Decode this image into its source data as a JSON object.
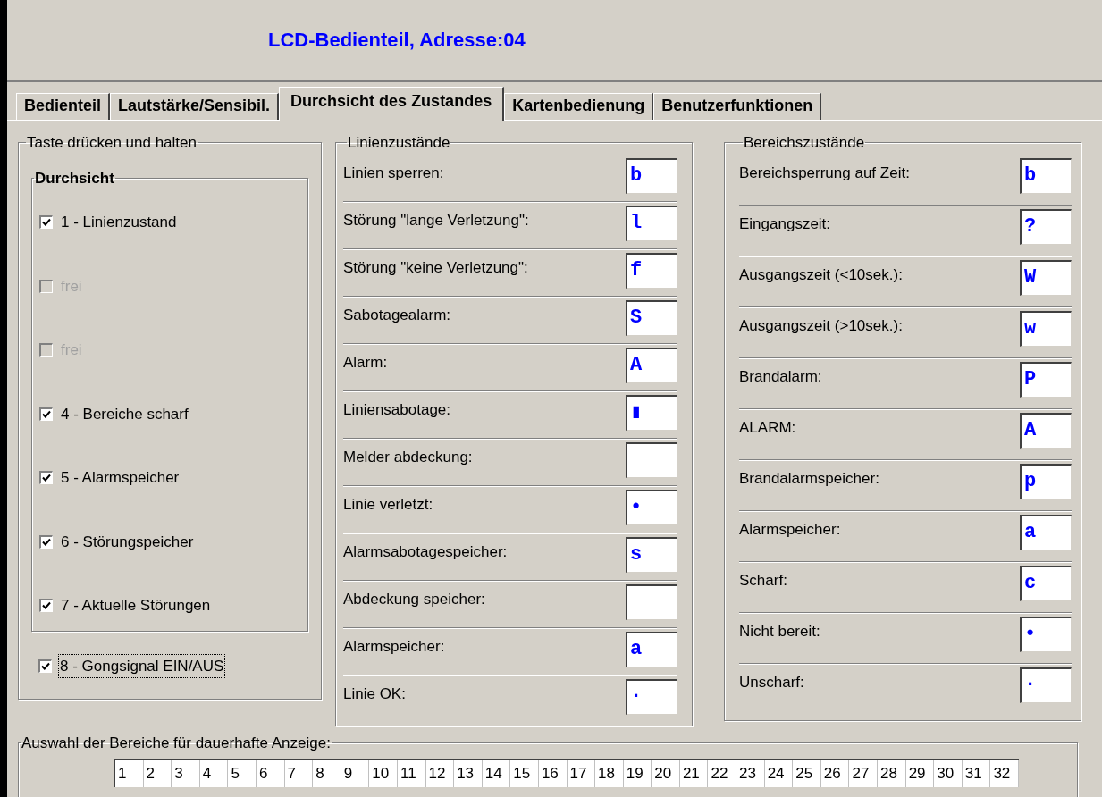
{
  "window": {
    "title": "LCD-Bedienteil, Adresse:04"
  },
  "tabs": [
    {
      "label": "Bedienteil",
      "selected": false
    },
    {
      "label": "Lautstärke/Sensibil.",
      "selected": false
    },
    {
      "label": "Durchsicht des Zustandes",
      "selected": true
    },
    {
      "label": "Kartenbedienung",
      "selected": false
    },
    {
      "label": "Benutzerfunktionen",
      "selected": false
    }
  ],
  "hold_key_group": {
    "title": "Taste drücken und halten",
    "review": {
      "title": "Durchsicht",
      "items": [
        {
          "label": "1 - Linienzustand",
          "checked": true,
          "disabled": false
        },
        {
          "label": "frei",
          "checked": false,
          "disabled": true
        },
        {
          "label": "frei",
          "checked": false,
          "disabled": true
        },
        {
          "label": "4 - Bereiche scharf",
          "checked": true,
          "disabled": false
        },
        {
          "label": "5 - Alarmspeicher",
          "checked": true,
          "disabled": false
        },
        {
          "label": "6 - Störungspeicher",
          "checked": true,
          "disabled": false
        },
        {
          "label": "7 - Aktuelle Störungen",
          "checked": true,
          "disabled": false
        }
      ]
    },
    "chime": {
      "label": "8 - Gongsignal EIN/AUS",
      "checked": true,
      "disabled": false,
      "focused": true
    }
  },
  "line_states": {
    "title": "Linienzustände",
    "rows": [
      {
        "label": "Linien sperren:",
        "value": "b"
      },
      {
        "label": "Störung \"lange Verletzung\":",
        "value": "l"
      },
      {
        "label": "Störung \"keine Verletzung\":",
        "value": "f"
      },
      {
        "label": "Sabotagealarm:",
        "value": "S"
      },
      {
        "label": "Alarm:",
        "value": "A"
      },
      {
        "label": "Liniensabotage:",
        "value": "▮"
      },
      {
        "label": "Melder abdeckung:"
      },
      {
        "label": "Linie verletzt:",
        "value": "•"
      },
      {
        "label": "Alarmsabotagespeicher:",
        "value": "s"
      },
      {
        "label": "Abdeckung speicher:"
      },
      {
        "label": "Alarmspeicher:",
        "value": "a"
      },
      {
        "label": "Linie OK:",
        "value": "·"
      }
    ]
  },
  "partition_states": {
    "title": "Bereichszustände",
    "rows": [
      {
        "label": "Bereichsperrung auf Zeit:",
        "value": "b"
      },
      {
        "label": "Eingangszeit:",
        "value": "?"
      },
      {
        "label": "Ausgangszeit (<10sek.):",
        "value": "W"
      },
      {
        "label": "Ausgangszeit (>10sek.):",
        "value": "w"
      },
      {
        "label": "Brandalarm:",
        "value": "P"
      },
      {
        "label": "ALARM:",
        "value": "A"
      },
      {
        "label": "Brandalarmspeicher:",
        "value": "p"
      },
      {
        "label": "Alarmspeicher:",
        "value": "a"
      },
      {
        "label": "Scharf:",
        "value": "c"
      },
      {
        "label": "Nicht bereit:",
        "value": "•"
      },
      {
        "label": "Unscharf:",
        "value": "·"
      }
    ]
  },
  "permanent_display": {
    "title": "Auswahl der Bereiche für dauerhafte Anzeige:",
    "partitions": [
      "1",
      "2",
      "3",
      "4",
      "5",
      "6",
      "7",
      "8",
      "9",
      "10",
      "11",
      "12",
      "13",
      "14",
      "15",
      "16",
      "17",
      "18",
      "19",
      "20",
      "21",
      "22",
      "23",
      "24",
      "25",
      "26",
      "27",
      "28",
      "29",
      "30",
      "31",
      "32"
    ]
  }
}
